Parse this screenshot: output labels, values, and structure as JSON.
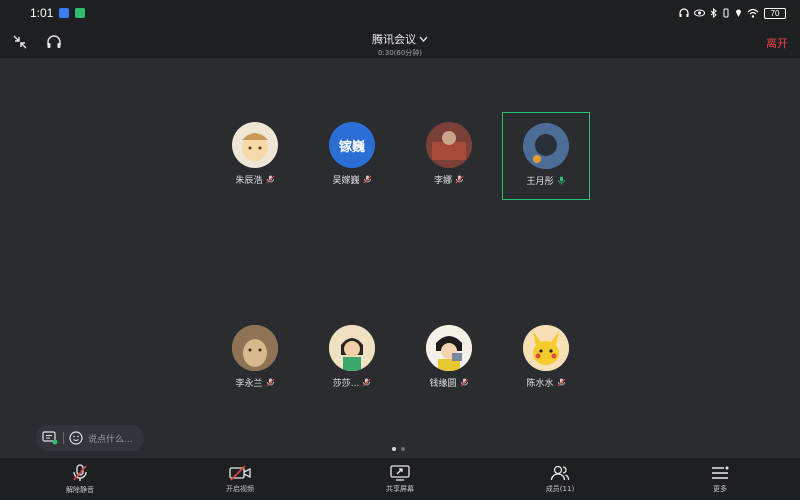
{
  "status": {
    "time": "1:01",
    "battery": "70"
  },
  "header": {
    "title": "腾讯会议",
    "subtitle": "0:30(60分钟)",
    "leave_label": "离开"
  },
  "participants": [
    {
      "name": "朱辰浩",
      "mic": "muted",
      "avatar_color": "#efe6d6"
    },
    {
      "name": "吴嫁巍",
      "mic": "muted",
      "avatar_text": "镓巍",
      "avatar_color": "#2b6fd6"
    },
    {
      "name": "李娜",
      "mic": "muted",
      "avatar_color": "#a84a3a"
    },
    {
      "name": "王月彤",
      "mic": "speaking",
      "avatar_color": "#5a7da8",
      "active": true
    },
    {
      "name": "李永兰",
      "mic": "muted",
      "avatar_color": "#b59870"
    },
    {
      "name": "莎莎...",
      "mic": "muted",
      "avatar_color": "#e7d7b5"
    },
    {
      "name": "钱缘圆",
      "mic": "muted",
      "avatar_color": "#f1dd3a"
    },
    {
      "name": "陈水水",
      "mic": "muted",
      "avatar_color": "#f3c93f"
    }
  ],
  "chat": {
    "placeholder": "说点什么..."
  },
  "pagination": {
    "current": 1,
    "total": 2
  },
  "toolbar": {
    "unmute_label": "解除静音",
    "video_label": "开启视频",
    "share_label": "共享屏幕",
    "members_label": "成员(11)",
    "more_label": "更多"
  },
  "colors": {
    "background": "#2a2c30",
    "bars": "#1e1f22",
    "leave": "#f0413f",
    "active_border": "#2fbf71",
    "mic_muted": "#e0463d",
    "mic_active": "#2fbf71"
  }
}
